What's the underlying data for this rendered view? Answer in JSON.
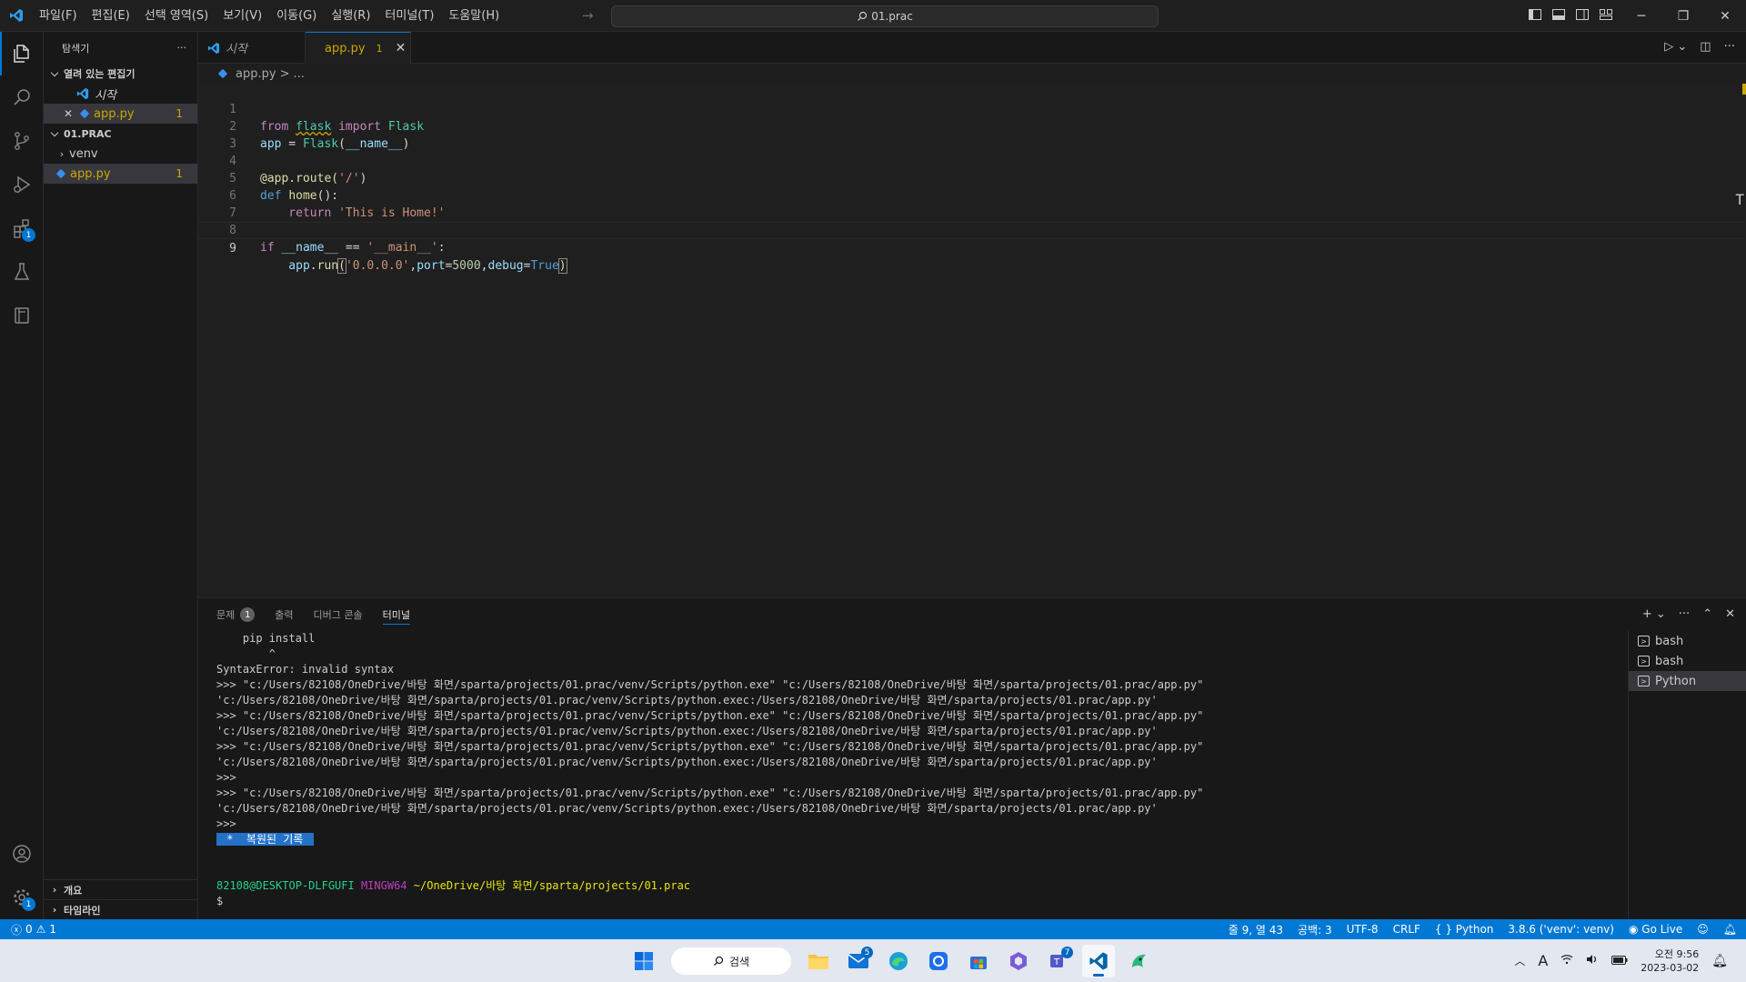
{
  "titlebar": {
    "menus": [
      "파일(F)",
      "편집(E)",
      "선택 영역(S)",
      "보기(V)",
      "이동(G)",
      "실행(R)",
      "터미널(T)",
      "도움말(H)"
    ],
    "search_text": "01.prac"
  },
  "activitybar": {
    "extensions_badge": "1",
    "settings_badge": "1"
  },
  "sidebar": {
    "title": "탐색기",
    "more": "···",
    "open_editors_label": "열려 있는 편집기",
    "open_editors": [
      {
        "label": "시작",
        "badge": ""
      },
      {
        "label": "app.py",
        "badge": "1"
      }
    ],
    "folder_label": "01.PRAC",
    "folder_items": [
      {
        "label": "venv",
        "badge": ""
      },
      {
        "label": "app.py",
        "badge": "1"
      }
    ],
    "outline_label": "개요",
    "timeline_label": "타임라인"
  },
  "tabs": [
    {
      "label": "시작",
      "badge": ""
    },
    {
      "label": "app.py",
      "badge": "1"
    }
  ],
  "breadcrumb": {
    "file": "app.py",
    "sep": ">",
    "rest": "..."
  },
  "editor": {
    "line_numbers": [
      "1",
      "2",
      "3",
      "4",
      "5",
      "6",
      "7",
      "8",
      "9"
    ],
    "lines": {
      "l1": {
        "a": "from ",
        "b": "flask",
        "c": " import ",
        "d": "Flask"
      },
      "l2": {
        "a": "app",
        "b": " = ",
        "c": "Flask",
        "d": "(",
        "e": "__name__",
        "f": ")"
      },
      "l4": {
        "a": "@app.route",
        "b": "(",
        "c": "'/'",
        "d": ")"
      },
      "l5": {
        "a": "def ",
        "b": "home",
        "c": "():"
      },
      "l6": {
        "a": "    return ",
        "b": "'This is Home!'"
      },
      "l8": {
        "a": "if ",
        "b": "__name__",
        "c": " == ",
        "d": "'__main__'",
        "e": ":"
      },
      "l9": {
        "a": "    app",
        "b": ".",
        "c": "run",
        "d": "(",
        "e": "'0.0.0.0'",
        "f": ",",
        "g": "port",
        "h": "=",
        "i": "5000",
        "j": ",",
        "k": "debug",
        "l": "=",
        "m": "True",
        "n": ")"
      }
    }
  },
  "panel": {
    "tabs": [
      {
        "label": "문제",
        "count": "1"
      },
      {
        "label": "출력"
      },
      {
        "label": "디버그 콘솔"
      },
      {
        "label": "터미널"
      }
    ],
    "terminal_lines": [
      "    pip install",
      "        ^",
      "SyntaxError: invalid syntax",
      ">>> \"c:/Users/82108/OneDrive/바탕 화면/sparta/projects/01.prac/venv/Scripts/python.exe\" \"c:/Users/82108/OneDrive/바탕 화면/sparta/projects/01.prac/app.py\"",
      "'c:/Users/82108/OneDrive/바탕 화면/sparta/projects/01.prac/venv/Scripts/python.exec:/Users/82108/OneDrive/바탕 화면/sparta/projects/01.prac/app.py'",
      ">>> \"c:/Users/82108/OneDrive/바탕 화면/sparta/projects/01.prac/venv/Scripts/python.exe\" \"c:/Users/82108/OneDrive/바탕 화면/sparta/projects/01.prac/app.py\"",
      "'c:/Users/82108/OneDrive/바탕 화면/sparta/projects/01.prac/venv/Scripts/python.exec:/Users/82108/OneDrive/바탕 화면/sparta/projects/01.prac/app.py'",
      ">>> \"c:/Users/82108/OneDrive/바탕 화면/sparta/projects/01.prac/venv/Scripts/python.exe\" \"c:/Users/82108/OneDrive/바탕 화면/sparta/projects/01.prac/app.py\"",
      "'c:/Users/82108/OneDrive/바탕 화면/sparta/projects/01.prac/venv/Scripts/python.exec:/Users/82108/OneDrive/바탕 화면/sparta/projects/01.prac/app.py'",
      ">>>",
      ">>> \"c:/Users/82108/OneDrive/바탕 화면/sparta/projects/01.prac/venv/Scripts/python.exe\" \"c:/Users/82108/OneDrive/바탕 화면/sparta/projects/01.prac/app.py\"",
      "'c:/Users/82108/OneDrive/바탕 화면/sparta/projects/01.prac/venv/Scripts/python.exec:/Users/82108/OneDrive/바탕 화면/sparta/projects/01.prac/app.py'",
      ">>>"
    ],
    "restored_label": " *  복원된 기록 ",
    "prompt_user": "82108@DESKTOP-DLFGUFI",
    "prompt_shell": "MINGW64",
    "prompt_path": "~/OneDrive/바탕 화면/sparta/projects/01.prac",
    "prompt_symbol": "$",
    "terminals": [
      "bash",
      "bash",
      "Python"
    ]
  },
  "statusbar": {
    "errors": "0",
    "warnings": "1",
    "position": "줄 9, 열 43",
    "spaces": "공백: 3",
    "encoding": "UTF-8",
    "eol": "CRLF",
    "language": "Python",
    "interpreter": "3.8.6 ('venv': venv)",
    "golive": "Go Live"
  },
  "taskbar": {
    "search_label": "검색",
    "mail_badge": "5",
    "teams_badge": "7",
    "ime": "A",
    "time": "오전 9:56",
    "date": "2023-03-02"
  },
  "colors": {
    "accent": "#0078d4",
    "warning": "#cca700",
    "terminal_green": "#23d18b",
    "terminal_purple": "#bc3fbc",
    "terminal_yellow": "#e5e510"
  }
}
